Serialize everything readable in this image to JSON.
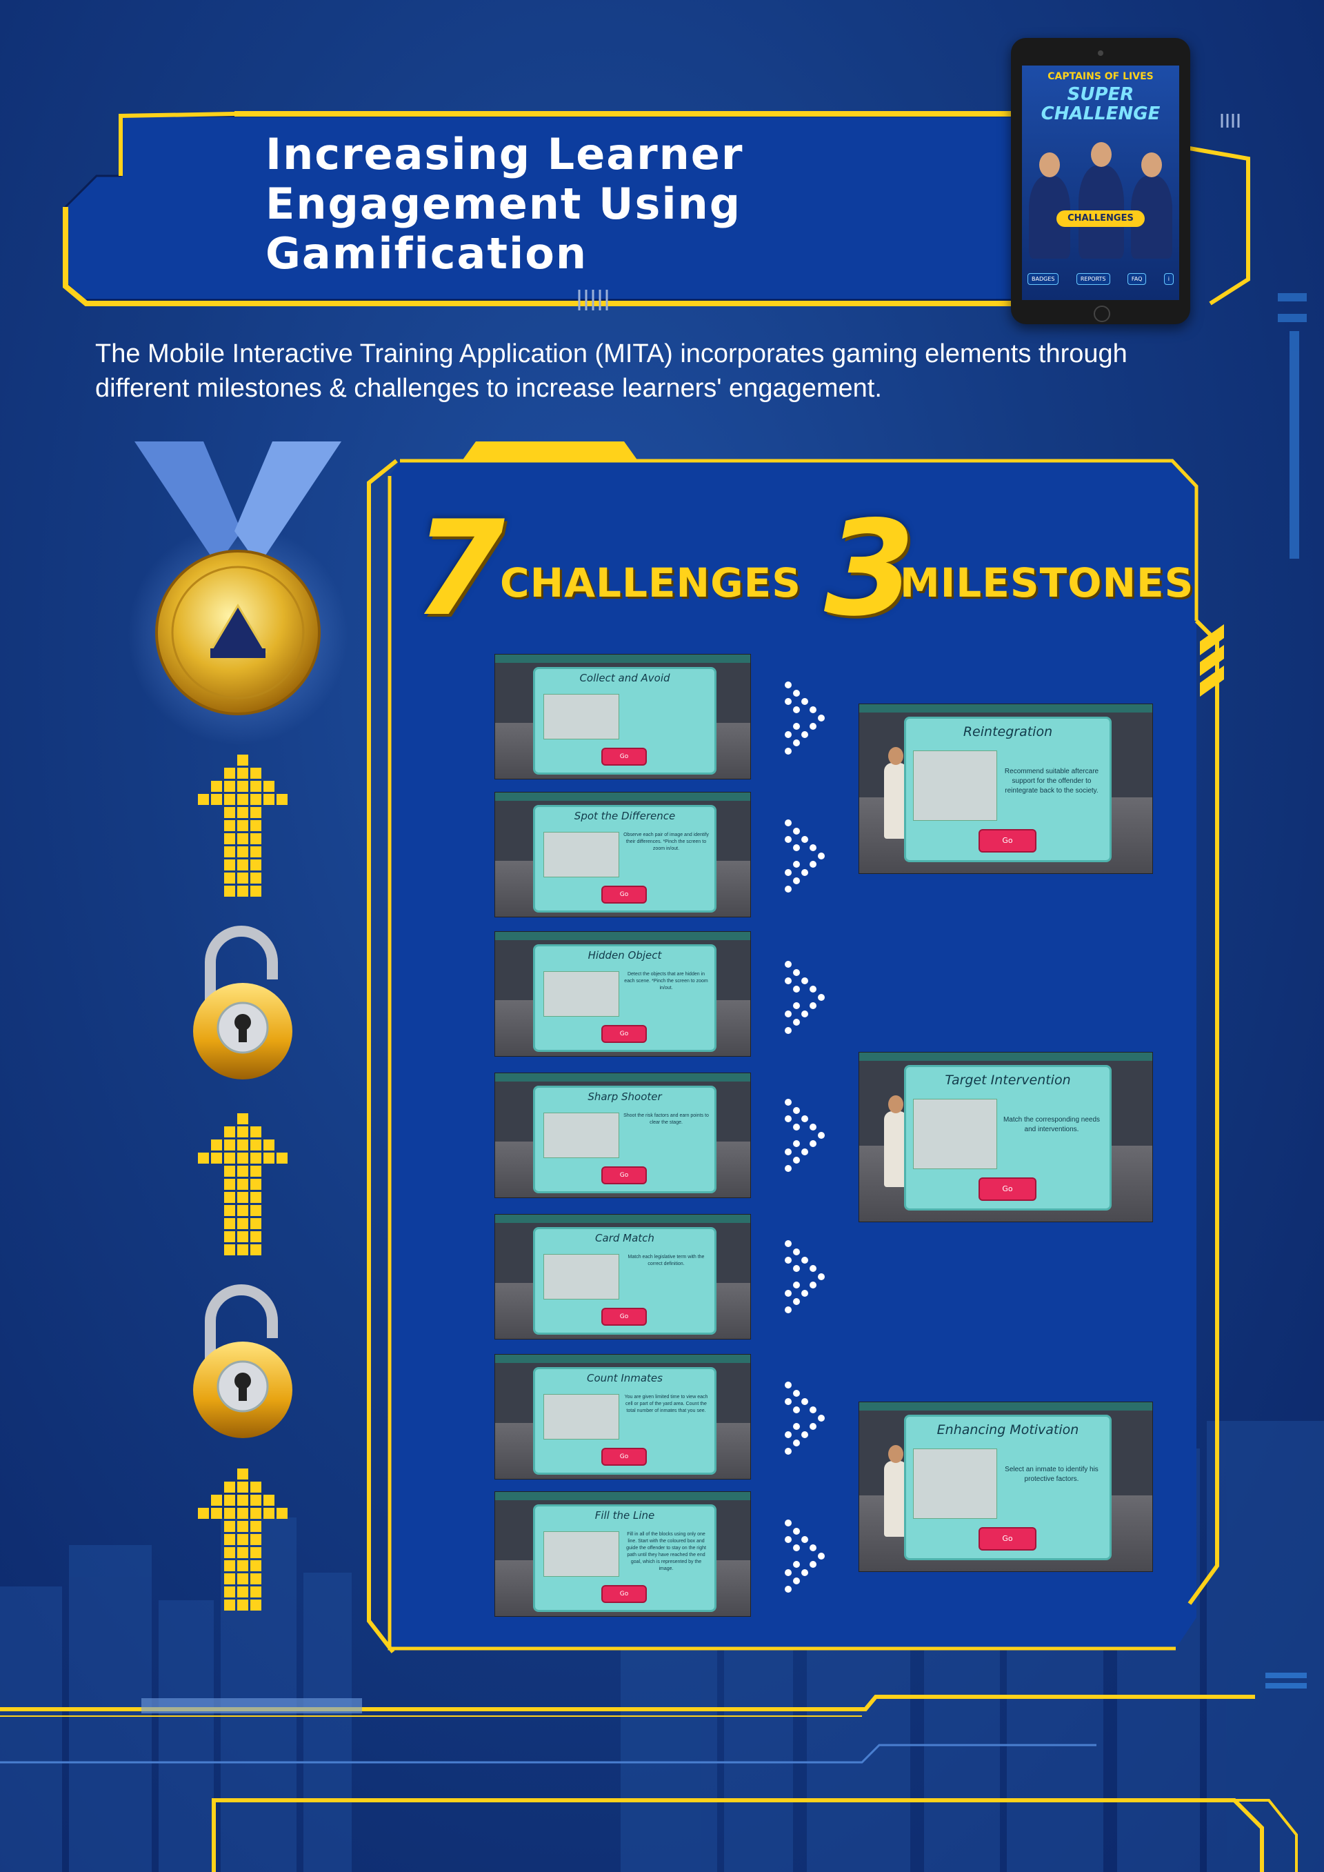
{
  "title": {
    "line1": "Increasing Learner",
    "line2": "Engagement Using",
    "line3": "Gamification"
  },
  "intro": {
    "line1": "The Mobile Interactive Training Application (MITA) incorporates gaming elements through",
    "line2": "different milestones & challenges to increase learners' engagement."
  },
  "tablet": {
    "subtitle": "CAPTAINS OF LIVES",
    "title": "SUPER CHALLENGE",
    "button": "CHALLENGES",
    "nav": [
      "BADGES",
      "REPORTS",
      "FAQ",
      "i"
    ]
  },
  "headings": {
    "challenges_num": "7",
    "challenges_word": "CHALLENGES",
    "milestones_num": "3",
    "milestones_word": "MILESTONES"
  },
  "challenges": [
    {
      "title": "Collect and Avoid",
      "desc": "",
      "go": "Go"
    },
    {
      "title": "Spot the Difference",
      "desc": "Observe each pair of image and identify their differences. *Pinch the screen to zoom in/out.",
      "go": "Go"
    },
    {
      "title": "Hidden Object",
      "desc": "Detect the objects that are hidden in each scene. *Pinch the screen to zoom in/out.",
      "go": "Go"
    },
    {
      "title": "Sharp Shooter",
      "desc": "Shoot the risk factors and earn points to clear the stage.",
      "go": "Go"
    },
    {
      "title": "Card Match",
      "desc": "Match each legislative term with the correct definition.",
      "go": "Go"
    },
    {
      "title": "Count Inmates",
      "desc": "You are given limited time to view each cell or part of the yard area. Count the total number of inmates that you see.",
      "go": "Go"
    },
    {
      "title": "Fill the Line",
      "desc": "Fill in all of the blocks using only one line. Start with the coloured box and guide the offender to stay on the right path until they have reached the end goal, which is represented by the image.",
      "go": "Go"
    }
  ],
  "milestones": [
    {
      "title": "Reintegration",
      "desc": "Recommend suitable aftercare support for the offender to reintegrate back to the society.",
      "go": "Go"
    },
    {
      "title": "Target Intervention",
      "desc": "Match the corresponding needs and interventions.",
      "go": "Go"
    },
    {
      "title": "Enhancing Motivation",
      "desc": "Select an inmate to identify his protective factors.",
      "go": "Go"
    }
  ],
  "colors": {
    "background": "#143a82",
    "accent_yellow": "#ffd21a",
    "panel_blue": "#0d3d9e",
    "dialog_teal": "#7fd8d4",
    "go_button": "#e8285a"
  },
  "icons": [
    "medal-icon",
    "padlock-icon",
    "arrow-up-icon",
    "chevron-dots-icon"
  ]
}
